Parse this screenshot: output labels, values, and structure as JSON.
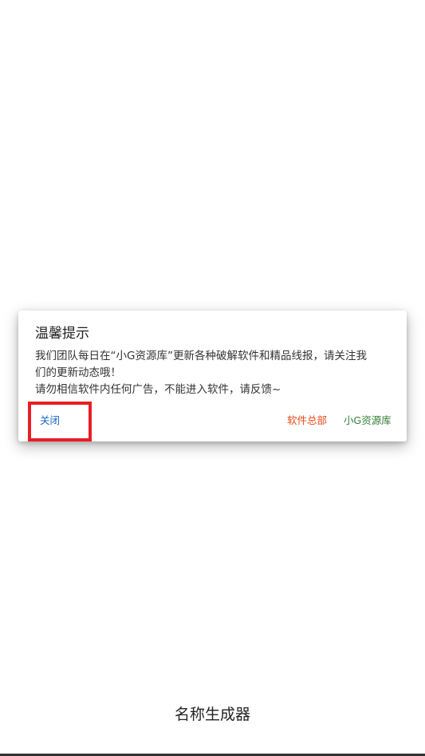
{
  "dialog": {
    "title": "温馨提示",
    "message_line1": "我们团队每日在“小G资源库”更新各种破解软件和精品线报，请关注我",
    "message_line2": "们的更新动态哦！",
    "message_line3": "请勿相信软件内任何广告，不能进入软件，请反馈~",
    "buttons": {
      "close": "关闭",
      "software_hq": "软件总部",
      "resource_lib": "小G资源库"
    },
    "button_colors": {
      "close": "#1565c0",
      "software_hq": "#e64a19",
      "resource_lib": "#2e7d32"
    }
  },
  "highlight": {
    "color": "#e81e25",
    "target": "close-button"
  },
  "app": {
    "title": "名称生成器"
  }
}
